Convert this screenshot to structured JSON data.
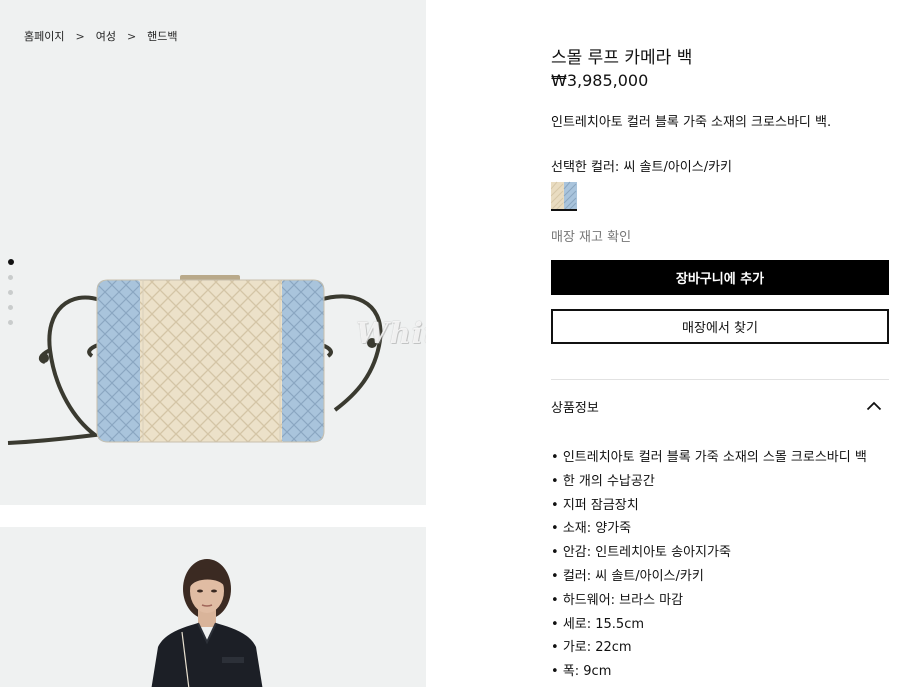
{
  "breadcrumb": [
    {
      "label": "홈페이지"
    },
    {
      "label": "여성"
    },
    {
      "label": "핸드백"
    }
  ],
  "breadcrumb_separator": ">",
  "gallery": {
    "image_count": 5,
    "active_index": 0,
    "watermark": "White Devil"
  },
  "product": {
    "title": "스몰 루프 카메라 백",
    "price": "₩3,985,000",
    "description": "인트레치아토 컬러 블록 가죽 소재의 크로스바디 백.",
    "color_label": "선택한 컬러: 씨 솔트/아이스/카키",
    "swatch_colors": [
      "#e9dcc1",
      "#a9c4dc"
    ],
    "stock_link": "매장 재고 확인",
    "add_to_cart": "장바구니에 추가",
    "find_in_store": "매장에서 찾기"
  },
  "info": {
    "title": "상품정보",
    "expanded": true,
    "items": [
      "인트레치아토 컬러 블록 가죽 소재의 스몰 크로스바디 백",
      "한 개의 수납공간",
      "지퍼 잠금장치",
      "소재: 양가죽",
      "안감: 인트레치아토 송아지가죽",
      "컬러: 씨 솔트/아이스/카키",
      "하드웨어: 브라스 마감",
      "세로: 15.5cm",
      "가로: 22cm",
      "폭: 9cm"
    ]
  },
  "colors": {
    "panel_bg": "#eff1f1",
    "bag_blue": "#a9c4dc",
    "bag_cream": "#ece1c9",
    "strap": "#3a3a30",
    "button_black": "#000000"
  }
}
